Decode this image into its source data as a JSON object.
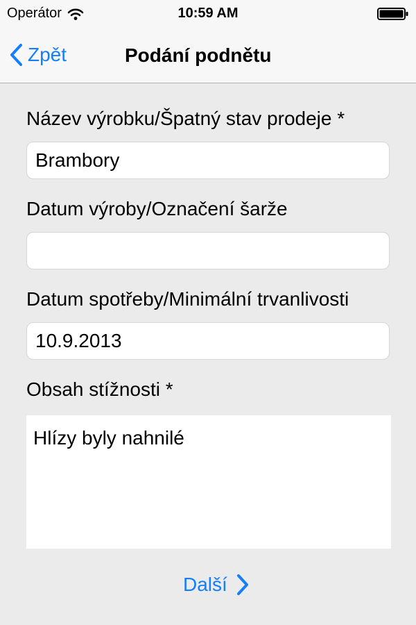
{
  "status_bar": {
    "carrier": "Operátor",
    "time": "10:59 AM"
  },
  "nav": {
    "back_label": "Zpět",
    "title": "Podání podnětu"
  },
  "form": {
    "product_label": "Název výrobku/Špatný stav prodeje *",
    "product_value": "Brambory",
    "batch_label": "Datum výroby/Označení šarže",
    "batch_value": "",
    "expiry_label": "Datum spotřeby/Minimální trvanlivosti",
    "expiry_value": "10.9.2013",
    "complaint_label": "Obsah stížnosti *",
    "complaint_value": "Hlízy byly nahnilé"
  },
  "footer": {
    "next_label": "Další"
  },
  "colors": {
    "accent": "#157efb",
    "background": "#ebebeb",
    "bar_background": "#f7f7f7"
  },
  "icons": [
    "wifi-icon",
    "battery-icon",
    "chevron-left-icon",
    "chevron-right-icon"
  ]
}
